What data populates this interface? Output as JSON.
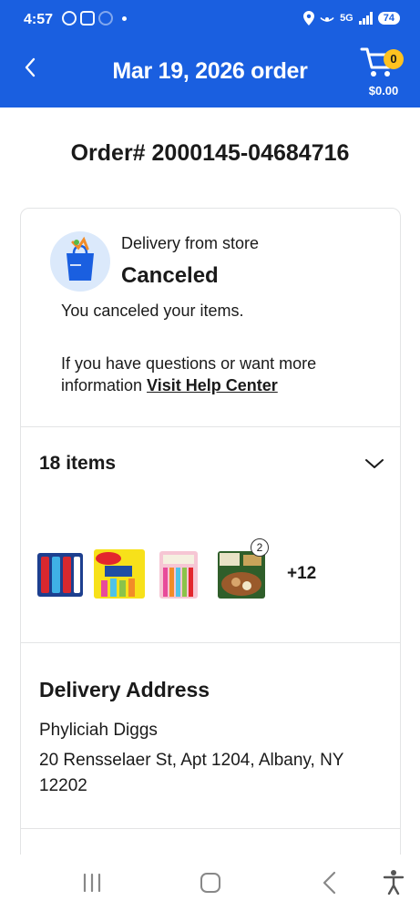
{
  "status_bar": {
    "time": "4:57",
    "network": "5G",
    "battery": "74"
  },
  "header": {
    "title": "Mar 19, 2026 order",
    "cart_count": "0",
    "cart_total": "$0.00"
  },
  "order": {
    "number": "Order# 2000145-04684716"
  },
  "delivery": {
    "type": "Delivery from store",
    "status": "Canceled",
    "message": "You canceled your items.",
    "help_prefix": "If you have questions or want more information ",
    "help_link": "Visit Help Center"
  },
  "items": {
    "count_label": "18 items",
    "thumbnails": [
      "icee-freeze-pops-icon",
      "popsicle-box-icon",
      "twin-pops-icon",
      "pulled-pork-meal-icon"
    ],
    "quantity_badge": "2",
    "more_label": "+12"
  },
  "address": {
    "heading": "Delivery Address",
    "name": "Phyliciah Diggs",
    "line": "20 Rensselaer St, Apt 1204, Albany, NY 12202"
  },
  "colors": {
    "header_bg": "#1a5fe0",
    "cart_badge": "#ffc220"
  }
}
